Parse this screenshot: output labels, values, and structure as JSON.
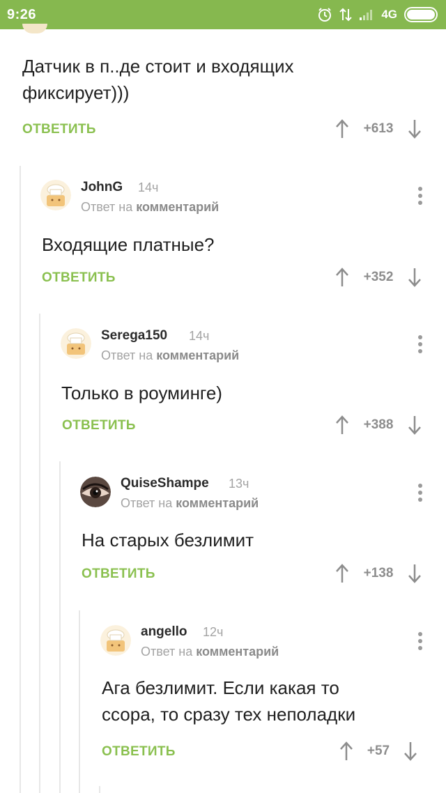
{
  "status_bar": {
    "time": "9:26",
    "network": "4G",
    "color": "#86b84f"
  },
  "accent_color": "#8ac04f",
  "top_comment": {
    "text_line1": "Датчик в п..де стоит и входящих",
    "text_line2": "фиксирует)))",
    "reply_label": "ОТВЕТИТЬ",
    "score": "+613"
  },
  "comments": [
    {
      "username": "JohnG",
      "time": "14ч",
      "reply_prefix": "Ответ на",
      "reply_target": "комментарий",
      "text": "Входящие платные?",
      "reply_label": "ОТВЕТИТЬ",
      "score": "+352",
      "avatar": "chef-hat-avatar"
    },
    {
      "username": "Serega150",
      "time": "14ч",
      "reply_prefix": "Ответ на",
      "reply_target": "комментарий",
      "text": "Только в роуминге)",
      "reply_label": "ОТВЕТИТЬ",
      "score": "+388",
      "avatar": "chef-hat-avatar"
    },
    {
      "username": "QuiseShampe",
      "time": "13ч",
      "reply_prefix": "Ответ на",
      "reply_target": "комментарий",
      "text": "На старых безлимит",
      "reply_label": "ОТВЕТИТЬ",
      "score": "+138",
      "avatar": "eye-photo-avatar"
    },
    {
      "username": "angello",
      "time": "12ч",
      "reply_prefix": "Ответ на",
      "reply_target": "комментарий",
      "text_line1": "Ага безлимит. Если какая то",
      "text_line2": "ссора, то сразу тех неполадки",
      "reply_label": "ОТВЕТИТЬ",
      "score": "+57",
      "avatar": "chef-hat-avatar"
    }
  ]
}
